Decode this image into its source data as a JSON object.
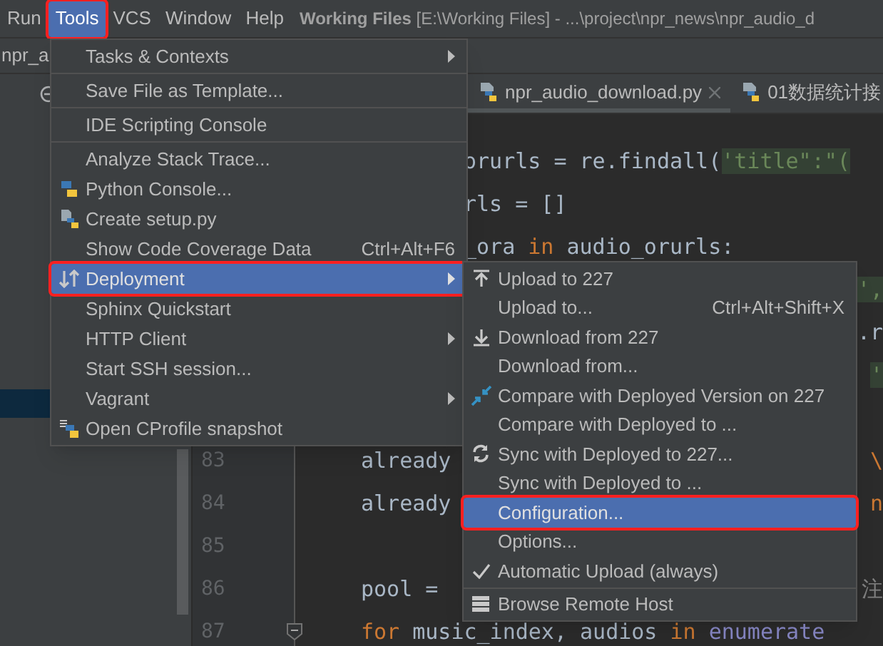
{
  "menubar": {
    "items": [
      {
        "label": "Run",
        "selected": false,
        "annotated": false
      },
      {
        "label": "Tools",
        "selected": true,
        "annotated": true
      },
      {
        "label": "VCS",
        "selected": false,
        "annotated": false
      },
      {
        "label": "Window",
        "selected": false,
        "annotated": false
      },
      {
        "label": "Help",
        "selected": false,
        "annotated": false
      }
    ],
    "title": "**Working Files** [E:\\Working Files] - ...\\project\\npr_news\\npr_audio_d"
  },
  "project_tab": {
    "label": "npr_a"
  },
  "editor": {
    "tabs": [
      {
        "label": "npr_audio_download.py",
        "selected": true,
        "closable": true
      },
      {
        "label": "01数据统计接",
        "selected": false,
        "closable": false
      }
    ],
    "lines": [
      {
        "kind": "clipped",
        "left": [
          {
            "text": "orurls = re.findall(",
            "kind": "plain"
          },
          {
            "text": "'title\":\"(",
            "kind": "string"
          }
        ]
      },
      {
        "kind": "clipped",
        "left": [
          {
            "text": "rls = []",
            "kind": "plain"
          }
        ]
      },
      {
        "kind": "clipped",
        "left": [
          {
            "text": "_ora ",
            "kind": "plain"
          },
          {
            "text": "in",
            "kind": "keyword"
          },
          {
            "text": " audio_orurls:",
            "kind": "plain"
          }
        ]
      },
      {
        "kind": "clipped",
        "right": [
          {
            "text": "',",
            "kind": "string"
          }
        ]
      },
      {
        "kind": "clipped",
        "right": [
          {
            "text": ".r",
            "kind": "plain"
          }
        ]
      },
      {
        "kind": "clipped",
        "right": [
          {
            "text": "'",
            "kind": "string"
          }
        ]
      },
      {
        "kind": "clipped"
      },
      {
        "kind": "full",
        "number": "83",
        "left": [
          {
            "text": "already",
            "kind": "plain"
          }
        ],
        "right": [
          {
            "text": "\\",
            "kind": "keyword"
          }
        ]
      },
      {
        "kind": "full",
        "number": "84",
        "left": [
          {
            "text": "already",
            "kind": "plain"
          }
        ],
        "right": [
          {
            "text": "n",
            "kind": "keyword"
          }
        ]
      },
      {
        "kind": "full",
        "number": "85"
      },
      {
        "kind": "full",
        "number": "86",
        "left": [
          {
            "text": "pool = ",
            "kind": "plain"
          }
        ],
        "right": [
          {
            "text": "注",
            "kind": "comment"
          }
        ]
      },
      {
        "kind": "full",
        "number": "87",
        "left": [
          {
            "text": "for",
            "kind": "keyword"
          },
          {
            "text": " music_index, audios ",
            "kind": "plain"
          },
          {
            "text": "in",
            "kind": "keyword"
          },
          {
            "text": " enumerate",
            "kind": "builtin"
          }
        ]
      }
    ]
  },
  "tools_menu": {
    "items": [
      {
        "kind": "item",
        "label": "Tasks & Contexts",
        "submenu": true,
        "selected": false,
        "annotated": false
      },
      {
        "kind": "separator"
      },
      {
        "kind": "item",
        "label": "Save File as Template...",
        "submenu": false,
        "selected": false,
        "annotated": false
      },
      {
        "kind": "separator"
      },
      {
        "kind": "item",
        "label": "IDE Scripting Console",
        "submenu": false,
        "selected": false,
        "annotated": false
      },
      {
        "kind": "separator"
      },
      {
        "kind": "item",
        "label": "Analyze Stack Trace...",
        "submenu": false,
        "selected": false,
        "annotated": false
      },
      {
        "kind": "item",
        "label": "Python Console...",
        "submenu": false,
        "selected": false,
        "annotated": false
      },
      {
        "kind": "item",
        "label": "Create setup.py",
        "submenu": false,
        "selected": false,
        "annotated": false
      },
      {
        "kind": "item",
        "label": "Show Code Coverage Data",
        "shortcut": "Ctrl+Alt+F6",
        "submenu": false,
        "selected": false,
        "annotated": false
      },
      {
        "kind": "item",
        "label": "Deployment",
        "submenu": true,
        "selected": true,
        "annotated": true
      },
      {
        "kind": "item",
        "label": "Sphinx Quickstart",
        "submenu": false,
        "selected": false,
        "annotated": false
      },
      {
        "kind": "item",
        "label": "HTTP Client",
        "submenu": true,
        "selected": false,
        "annotated": false
      },
      {
        "kind": "item",
        "label": "Start SSH session...",
        "submenu": false,
        "selected": false,
        "annotated": false
      },
      {
        "kind": "item",
        "label": "Vagrant",
        "submenu": true,
        "selected": false,
        "annotated": false
      },
      {
        "kind": "item",
        "label": "Open CProfile snapshot",
        "submenu": false,
        "selected": false,
        "annotated": false
      }
    ]
  },
  "deployment_menu": {
    "items": [
      {
        "kind": "item",
        "label": "Upload to 227",
        "selected": false,
        "annotated": false
      },
      {
        "kind": "item",
        "label": "Upload to...",
        "shortcut": "Ctrl+Alt+Shift+X",
        "selected": false,
        "annotated": false
      },
      {
        "kind": "item",
        "label": "Download from 227",
        "selected": false,
        "annotated": false
      },
      {
        "kind": "item",
        "label": "Download from...",
        "selected": false,
        "annotated": false
      },
      {
        "kind": "item",
        "label": "Compare with Deployed Version on 227",
        "selected": false,
        "annotated": false
      },
      {
        "kind": "item",
        "label": "Compare with Deployed to ...",
        "selected": false,
        "annotated": false
      },
      {
        "kind": "item",
        "label": "Sync with Deployed to 227...",
        "selected": false,
        "annotated": false
      },
      {
        "kind": "item",
        "label": "Sync with Deployed to ...",
        "selected": false,
        "annotated": false
      },
      {
        "kind": "item",
        "label": "Configuration...",
        "selected": true,
        "annotated": true
      },
      {
        "kind": "item",
        "label": "Options...",
        "selected": false,
        "annotated": false
      },
      {
        "kind": "item",
        "label": "Automatic Upload (always)",
        "checked": true,
        "selected": false,
        "annotated": false
      },
      {
        "kind": "separator"
      },
      {
        "kind": "item",
        "label": "Browse Remote Host",
        "selected": false,
        "annotated": false
      }
    ]
  }
}
